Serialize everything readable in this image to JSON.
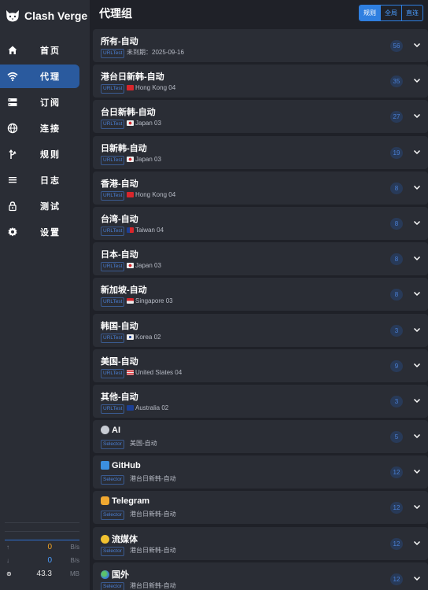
{
  "app": {
    "title": "Clash Verge"
  },
  "sidebar": {
    "items": [
      {
        "label": "首页",
        "icon": "home-icon"
      },
      {
        "label": "代理",
        "icon": "wifi-icon",
        "active": true
      },
      {
        "label": "订阅",
        "icon": "subscription-icon"
      },
      {
        "label": "连接",
        "icon": "globe-icon"
      },
      {
        "label": "规则",
        "icon": "fork-icon"
      },
      {
        "label": "日志",
        "icon": "list-icon"
      },
      {
        "label": "测试",
        "icon": "lock-icon"
      },
      {
        "label": "设置",
        "icon": "gear-icon"
      }
    ]
  },
  "traffic": {
    "upload": {
      "value": "0",
      "unit": "B/s"
    },
    "download": {
      "value": "0",
      "unit": "B/s"
    },
    "memory": {
      "value": "43.3",
      "unit": "MB"
    }
  },
  "main": {
    "title": "代理组",
    "modes": [
      "规则",
      "全局",
      "直连"
    ],
    "active_mode": "规则"
  },
  "groups": [
    {
      "name": "所有-自动",
      "type": "URLTest",
      "now": "未到期：2025-09-16",
      "count": "56"
    },
    {
      "name": "港台日新韩-自动",
      "type": "URLTest",
      "now": "Hong Kong 04",
      "count": "35"
    },
    {
      "name": "台日新韩-自动",
      "type": "URLTest",
      "now": "Japan 03",
      "count": "27"
    },
    {
      "name": "日新韩-自动",
      "type": "URLTest",
      "now": "Japan 03",
      "count": "19"
    },
    {
      "name": "香港-自动",
      "type": "URLTest",
      "now": "Hong Kong 04",
      "count": "8"
    },
    {
      "name": "台湾-自动",
      "type": "URLTest",
      "now": "Taiwan 04",
      "count": "8"
    },
    {
      "name": "日本-自动",
      "type": "URLTest",
      "now": "Japan 03",
      "count": "8"
    },
    {
      "name": "新加坡-自动",
      "type": "URLTest",
      "now": "Singapore 03",
      "count": "8"
    },
    {
      "name": "韩国-自动",
      "type": "URLTest",
      "now": "Korea 02",
      "count": "3"
    },
    {
      "name": "美国-自动",
      "type": "URLTest",
      "now": "United States 04",
      "count": "9"
    },
    {
      "name": "其他-自动",
      "type": "URLTest",
      "now": "Australia 02",
      "count": "3"
    },
    {
      "name": "AI",
      "type": "Selector",
      "now": "美国-自动",
      "count": "5"
    },
    {
      "name": "GitHub",
      "type": "Selector",
      "now": "港台日新韩-自动",
      "count": "12"
    },
    {
      "name": "Telegram",
      "type": "Selector",
      "now": "港台日新韩-自动",
      "count": "12"
    },
    {
      "name": "流媒体",
      "type": "Selector",
      "now": "港台日新韩-自动",
      "count": "12"
    },
    {
      "name": "国外",
      "type": "Selector",
      "now": "港台日新韩-自动",
      "count": "12"
    }
  ]
}
